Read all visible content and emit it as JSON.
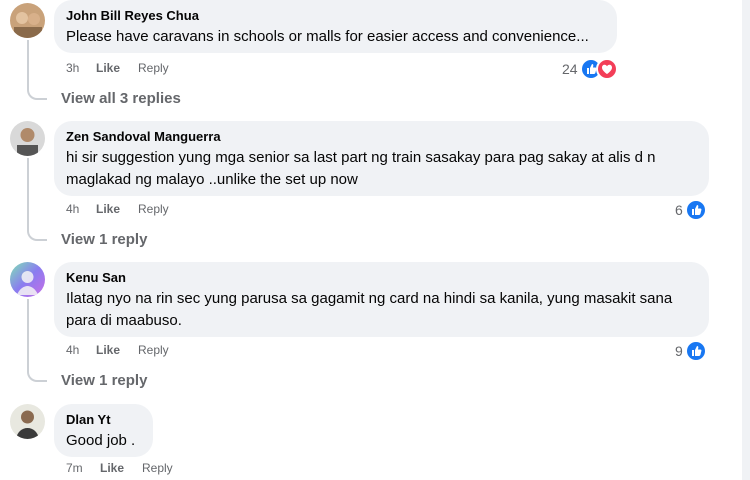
{
  "comments": [
    {
      "author": "John Bill Reyes Chua",
      "text": "Please have caravans in schools or malls for easier access and convenience...",
      "time": "3h",
      "like": "Like",
      "reply": "Reply",
      "reaction_count": "24",
      "view_replies": "View all 3 replies"
    },
    {
      "author": "Zen Sandoval Manguerra",
      "text": "hi sir suggestion yung mga senior sa last part ng train sasakay para pag sakay at alis d n maglakad ng malayo ..unlike the set up now",
      "time": "4h",
      "like": "Like",
      "reply": "Reply",
      "reaction_count": "6",
      "view_replies": "View 1 reply"
    },
    {
      "author": "Kenu San",
      "text": "Ilatag nyo na rin sec yung parusa sa gagamit ng card na hindi sa kanila, yung masakit sana para di maabuso.",
      "time": "4h",
      "like": "Like",
      "reply": "Reply",
      "reaction_count": "9",
      "view_replies": "View 1 reply"
    },
    {
      "author": "Dlan Yt",
      "text": "Good job .",
      "time": "7m",
      "like": "Like",
      "reply": "Reply"
    }
  ],
  "colors": {
    "like_blue": "#1877f2",
    "love_red": "#f33e58",
    "bubble": "#f0f2f5",
    "meta_gray": "#65676b"
  },
  "icons": [
    "like-reaction-icon",
    "love-reaction-icon"
  ]
}
